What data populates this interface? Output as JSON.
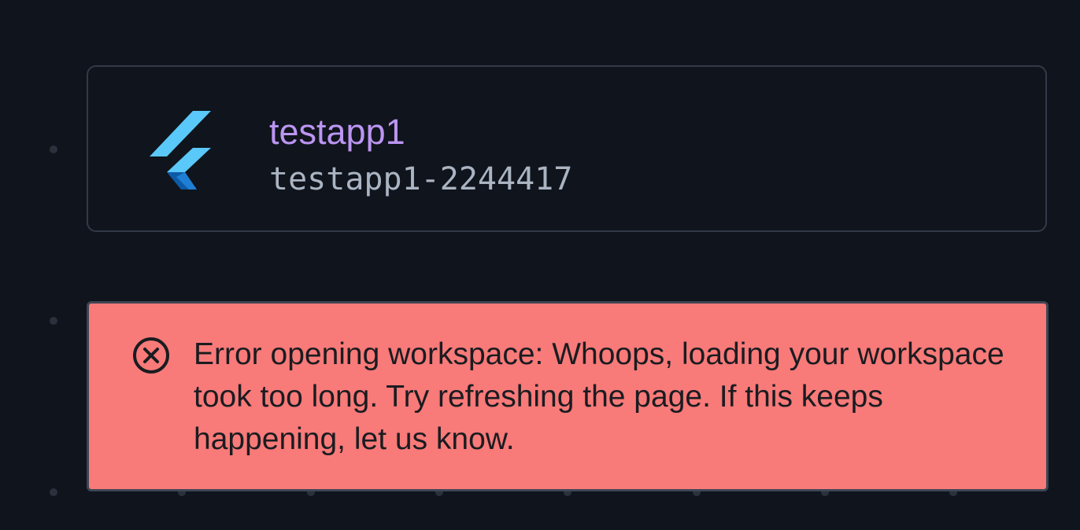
{
  "project": {
    "name": "testapp1",
    "id": "testapp1-2244417",
    "logo_icon": "flutter-logo-icon"
  },
  "error": {
    "icon": "circle-x-icon",
    "message": "Error opening workspace: Whoops, loading your workspace took too long. Try refreshing the page. If this keeps happening, let us know."
  },
  "colors": {
    "background": "#10141c",
    "card_border": "#323a47",
    "project_name": "#bc95f2",
    "project_id": "#aab4c2",
    "error_background": "#f87a79",
    "error_text": "#1a1c20",
    "flutter_light": "#5ac8f8",
    "flutter_mid": "#29b6f6",
    "flutter_dark": "#0d5aa7"
  }
}
